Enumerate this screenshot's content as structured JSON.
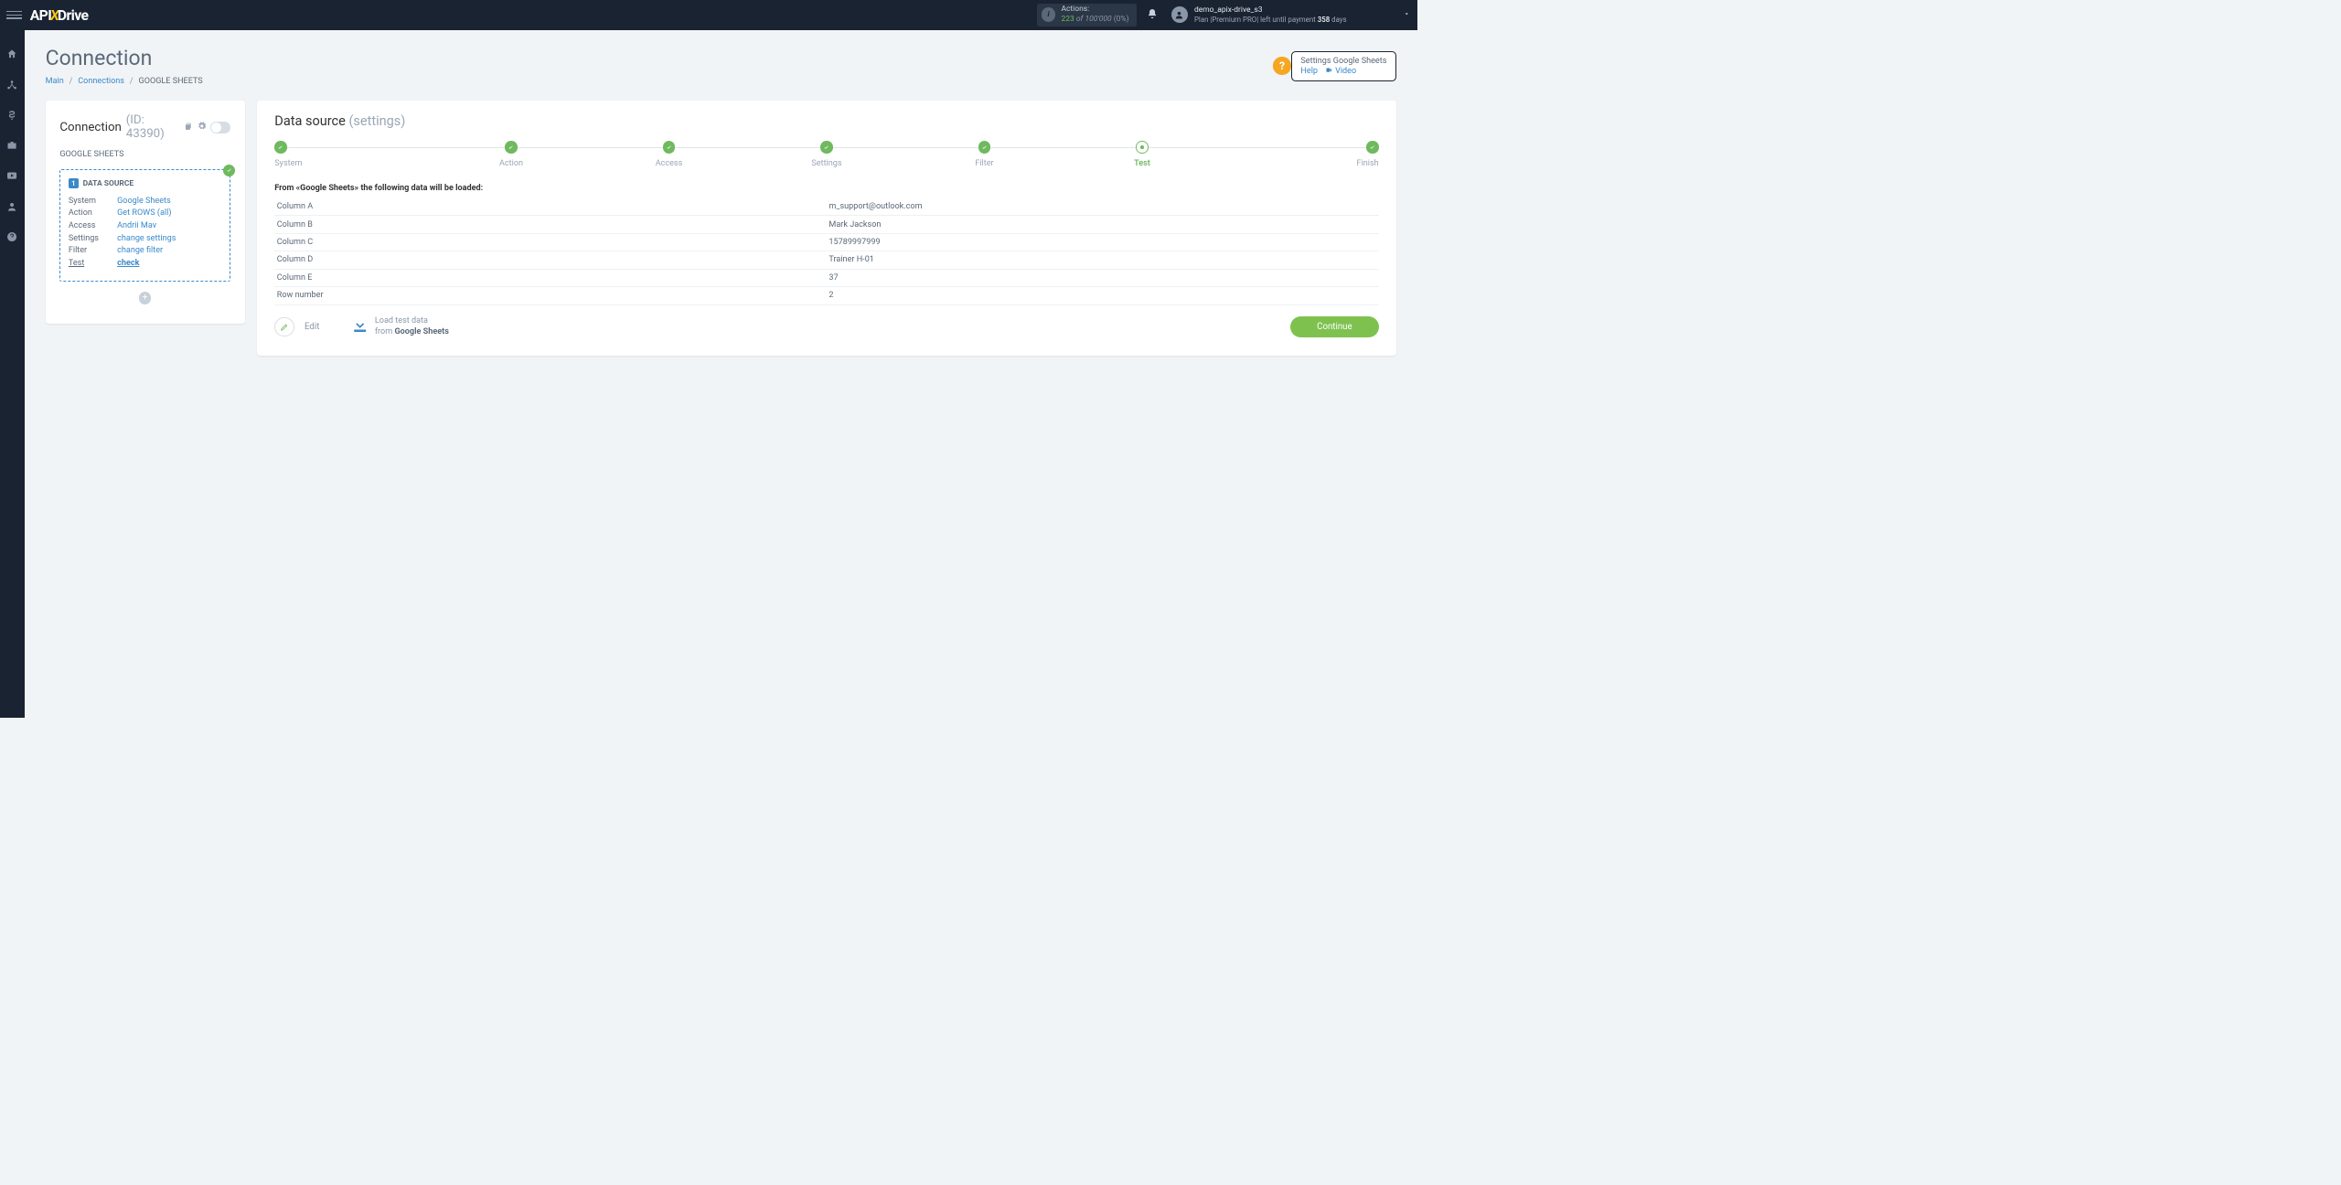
{
  "topbar": {
    "actions_label": "Actions:",
    "actions_used": "223",
    "actions_of": "of",
    "actions_total": "100'000",
    "actions_pct": "(0%)",
    "user": "demo_apix-drive_s3",
    "plan_prefix": "Plan |",
    "plan_name": "Premium PRO",
    "plan_mid": "| left until payment",
    "plan_days": "358",
    "plan_suffix": "days"
  },
  "page": {
    "title": "Connection",
    "bc_main": "Main",
    "bc_conn": "Connections",
    "bc_cur": "GOOGLE SHEETS",
    "help_title": "Settings Google Sheets",
    "help_link": "Help",
    "video_link": "Video"
  },
  "left": {
    "title": "Connection",
    "cid": "(ID: 43390)",
    "service": "GOOGLE SHEETS",
    "ds_title": "DATA SOURCE",
    "rows": [
      {
        "k": "System",
        "v": "Google Sheets"
      },
      {
        "k": "Action",
        "v": "Get ROWS (all)"
      },
      {
        "k": "Access",
        "v": "Andrii Mav"
      },
      {
        "k": "Settings",
        "v": "change settings"
      },
      {
        "k": "Filter",
        "v": "change filter"
      },
      {
        "k": "Test",
        "v": "check"
      }
    ]
  },
  "right": {
    "title": "Data source",
    "subtitle": "(settings)",
    "steps": [
      "System",
      "Action",
      "Access",
      "Settings",
      "Filter",
      "Test",
      "Finish"
    ],
    "load_heading": "From «Google Sheets» the following data will be loaded:",
    "table": [
      {
        "k": "Column A",
        "v": "m_support@outlook.com"
      },
      {
        "k": "Column B",
        "v": "Mark Jackson"
      },
      {
        "k": "Column C",
        "v": "15789997999"
      },
      {
        "k": "Column D",
        "v": "Trainer H-01"
      },
      {
        "k": "Column E",
        "v": "37"
      },
      {
        "k": "Row number",
        "v": "2"
      }
    ],
    "edit": "Edit",
    "load_l1": "Load test data",
    "load_l2a": "from",
    "load_l2b": "Google Sheets",
    "continue": "Continue"
  }
}
